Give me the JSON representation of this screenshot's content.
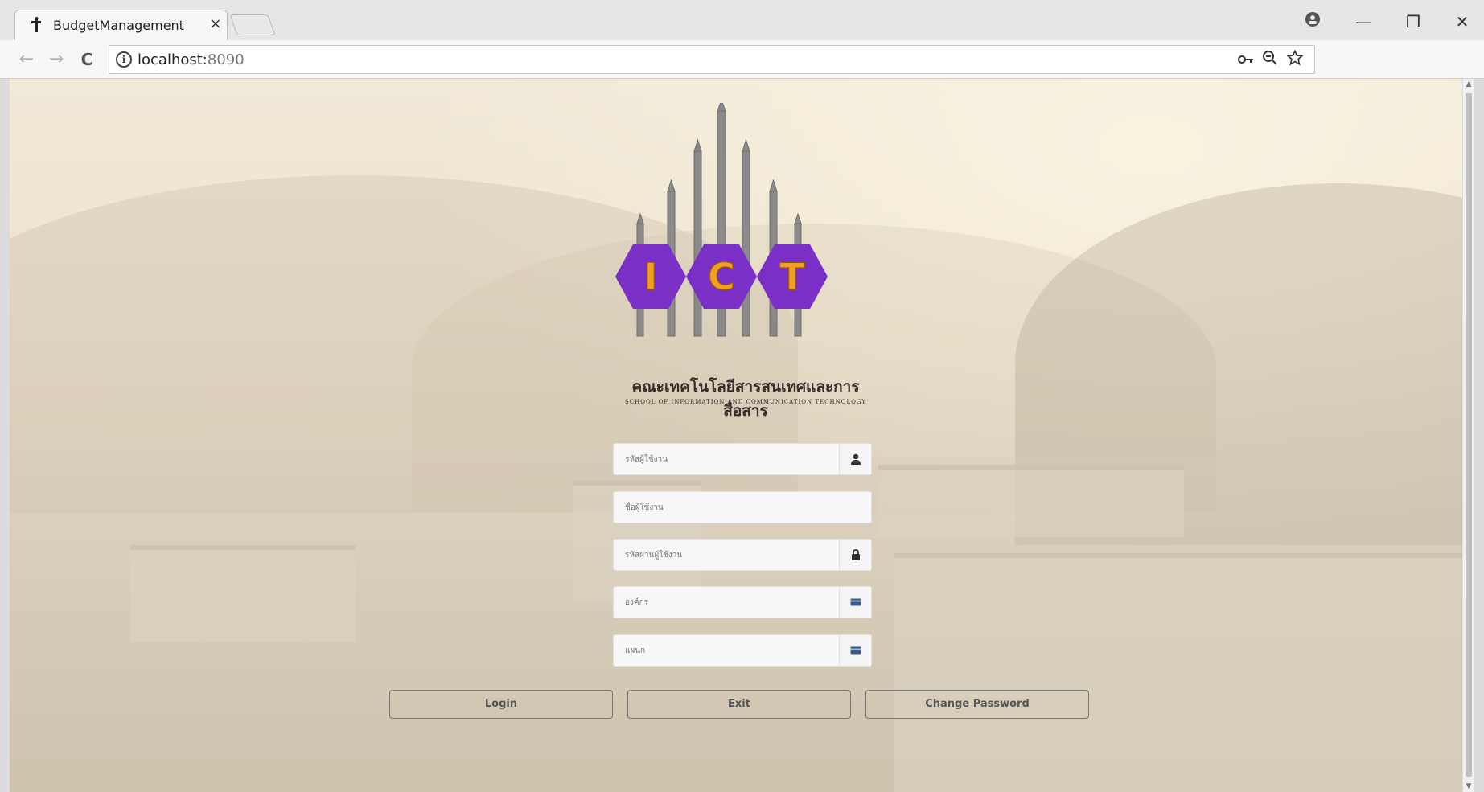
{
  "browser": {
    "tab_title": "BudgetManagement",
    "tab_close": "×",
    "url_host": "localhost:",
    "url_port": "8090",
    "window_controls": {
      "profile": "⊖",
      "minimize": "—",
      "restore": "❐",
      "close": "✕"
    },
    "nav": {
      "back": "←",
      "forward": "→",
      "reload": "C"
    },
    "omnibox_icons": {
      "key": "key-icon",
      "zoom": "zoom-icon",
      "star": "star-icon"
    }
  },
  "logo": {
    "letters": [
      "I",
      "C",
      "T"
    ],
    "thai_name": "คณะเทคโนโลยีสารสนเทศและการสื่อสาร",
    "english_name": "SCHOOL OF INFORMATION AND COMMUNICATION TECHNOLOGY",
    "colors": {
      "hexagon": "#7a2fc6",
      "letter": "#f0a020",
      "pillar": "#8a8a8a"
    }
  },
  "form": {
    "fields": [
      {
        "placeholder": "รหัสผู้ใช้งาน",
        "icon": "user-icon"
      },
      {
        "placeholder": "ชื่อผู้ใช้งาน",
        "icon": ""
      },
      {
        "placeholder": "รหัสผ่านผู้ใช้งาน",
        "icon": "lock-icon"
      },
      {
        "placeholder": "องค์กร",
        "icon": "card-icon"
      },
      {
        "placeholder": "แผนก",
        "icon": "card-icon"
      }
    ],
    "buttons": {
      "login": "Login",
      "exit": "Exit",
      "change_password": "Change Password"
    }
  }
}
